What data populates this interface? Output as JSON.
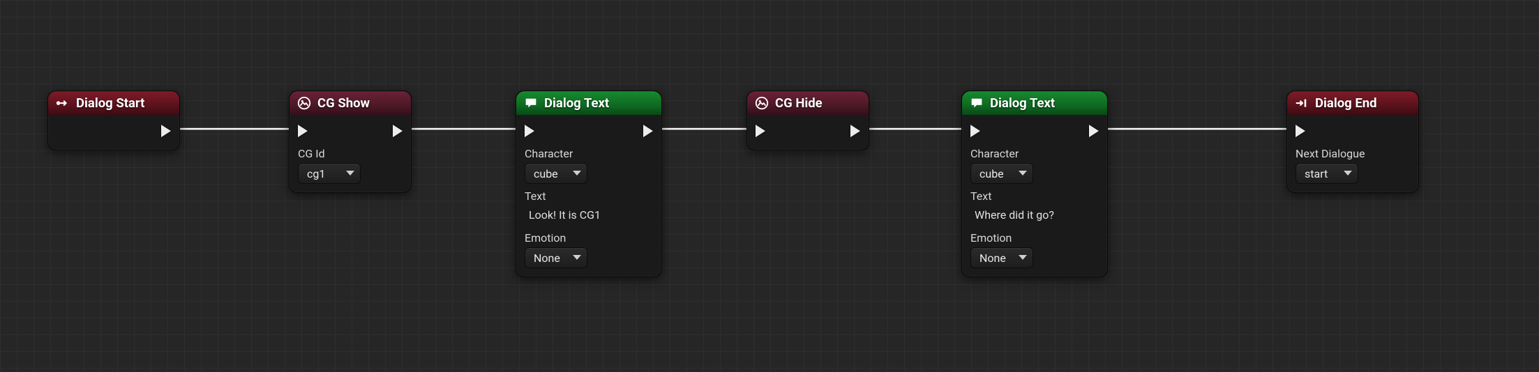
{
  "nodes": {
    "dialogStart": {
      "title": "Dialog Start"
    },
    "cgShow": {
      "title": "CG Show",
      "fields": {
        "cgId_label": "CG Id",
        "cgId_value": "cg1"
      }
    },
    "dialogText1": {
      "title": "Dialog Text",
      "fields": {
        "character_label": "Character",
        "character_value": "cube",
        "text_label": "Text",
        "text_value": "Look! It is CG1",
        "emotion_label": "Emotion",
        "emotion_value": "None"
      }
    },
    "cgHide": {
      "title": "CG Hide"
    },
    "dialogText2": {
      "title": "Dialog Text",
      "fields": {
        "character_label": "Character",
        "character_value": "cube",
        "text_label": "Text",
        "text_value": "Where did it go?",
        "emotion_label": "Emotion",
        "emotion_value": "None"
      }
    },
    "dialogEnd": {
      "title": "Dialog End",
      "fields": {
        "next_label": "Next Dialogue",
        "next_value": "start"
      }
    }
  }
}
